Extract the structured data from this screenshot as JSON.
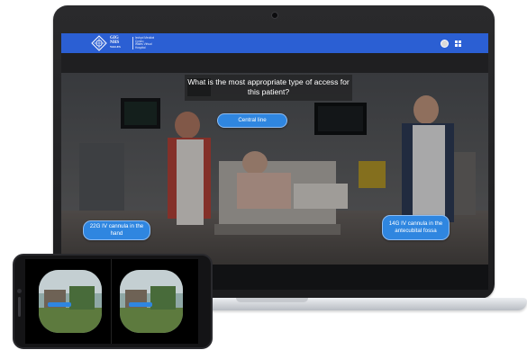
{
  "header": {
    "logo_mark": "GIG",
    "logo_label": "NHS",
    "logo_country": "WALES",
    "org_lines": [
      "Iechyd Meddwl",
      "Cymru",
      "Wales Virtual",
      "Hospital"
    ],
    "brand_color": "#2b5fd3"
  },
  "scenario": {
    "question": "What is the most appropriate type of access for this patient?",
    "answers": {
      "central": "Central line",
      "cannula_22g": "22G IV cannula in the hand",
      "cannula_14g": "14G IV cannula in the antecubital fossa"
    },
    "button_color": "#2f86e0"
  },
  "icons": {
    "avatar": "user-avatar-icon",
    "menu": "grid-menu-icon",
    "logo": "nhs-wales-logo"
  },
  "devices": {
    "laptop": "laptop-frame",
    "phone": "vr-phone-frame"
  }
}
